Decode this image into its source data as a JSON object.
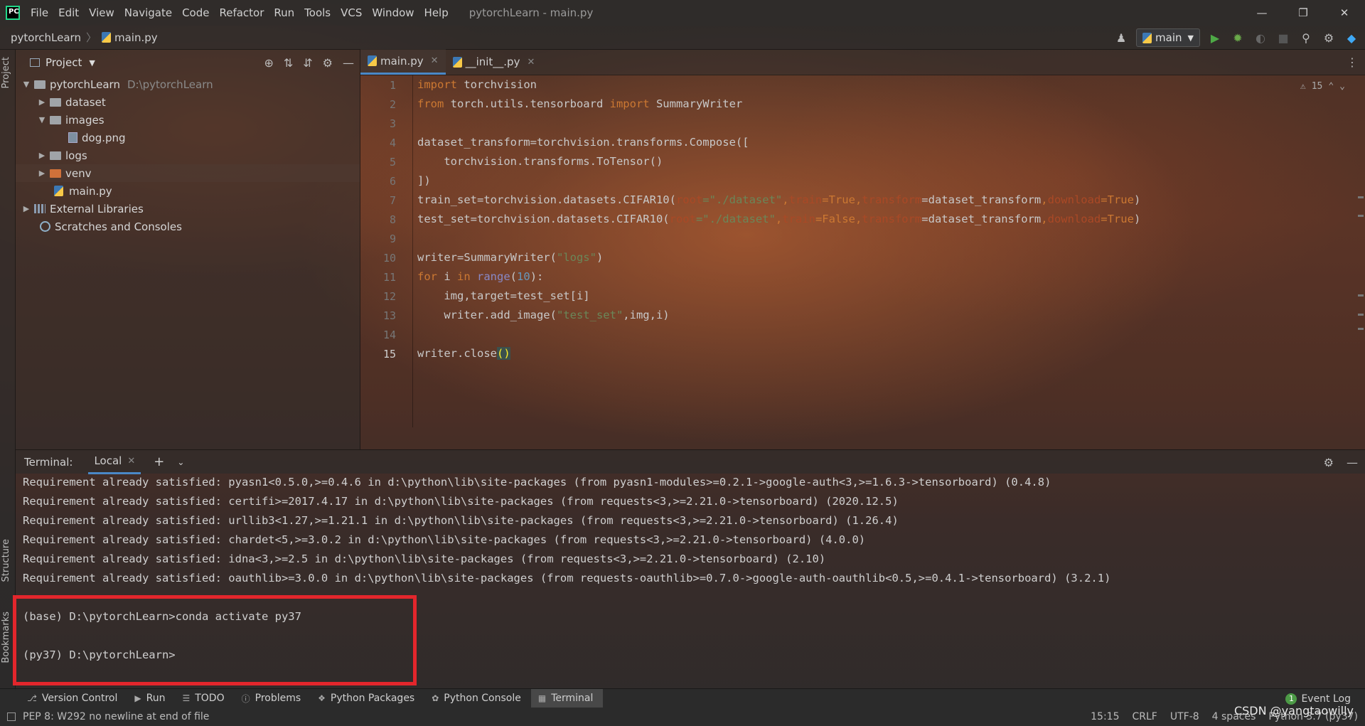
{
  "app": {
    "logo_text": "PC",
    "menu": [
      "File",
      "Edit",
      "View",
      "Navigate",
      "Code",
      "Refactor",
      "Run",
      "Tools",
      "VCS",
      "Window",
      "Help"
    ],
    "window_title": "pytorchLearn - main.py",
    "window_controls": {
      "minimize": "—",
      "restore": "❐",
      "close": "✕"
    }
  },
  "navbar": {
    "project": "pytorchLearn",
    "file": "main.py",
    "run_config": "main"
  },
  "left_stripe": {
    "project_tab": "Project",
    "structure_tab": "Structure",
    "bookmarks_tab": "Bookmarks"
  },
  "project_panel": {
    "title": "Project",
    "tree": {
      "root": {
        "name": "pytorchLearn",
        "path": "D:\\pytorchLearn"
      },
      "dataset": "dataset",
      "images": "images",
      "dog": "dog.png",
      "logs": "logs",
      "venv": "venv",
      "main": "main.py",
      "ext_libs": "External Libraries",
      "scratches": "Scratches and Consoles"
    }
  },
  "editor": {
    "tabs": [
      {
        "label": "main.py"
      },
      {
        "label": "__init__.py"
      }
    ],
    "warnings": "15",
    "line_numbers": [
      "1",
      "2",
      "3",
      "4",
      "5",
      "6",
      "7",
      "8",
      "9",
      "10",
      "11",
      "12",
      "13",
      "14",
      "15"
    ],
    "lines": {
      "l1": {
        "a": "import",
        "b": " torchvision"
      },
      "l2": {
        "a": "from",
        "b": " torch.utils.tensorboard ",
        "c": "import",
        "d": " SummaryWriter"
      },
      "l4": "dataset_transform=torchvision.transforms.Compose([",
      "l5": "    torchvision.transforms.ToTensor()",
      "l6": "])",
      "l7": {
        "a": "train_set=torchvision.datasets.CIFAR10(",
        "p1": "root",
        "s1": "=\"./dataset\"",
        "c1": ",",
        "p2": "train",
        "v2": "=True",
        "c2": ",",
        "p3": "transform",
        "v3": "=dataset_transform",
        "c3": ",",
        "p4": "download",
        "v4": "=True",
        "e": ")"
      },
      "l8": {
        "a": "test_set=torchvision.datasets.CIFAR10(",
        "p1": "root",
        "s1": "=\"./dataset\"",
        "c1": ",",
        "p2": "train",
        "v2": "=False",
        "c2": ",",
        "p3": "transform",
        "v3": "=dataset_transform",
        "c3": ",",
        "p4": "download",
        "v4": "=True",
        "e": ")"
      },
      "l10": {
        "a": "writer=SummaryWriter(",
        "s": "\"logs\"",
        "e": ")"
      },
      "l11": {
        "k1": "for",
        "b": " i ",
        "k2": "in",
        "f": " range",
        "o": "(",
        "n": "10",
        "e": "):"
      },
      "l12": "    img,target=test_set[i]",
      "l13": {
        "a": "    writer.add_image(",
        "s": "\"test_set\"",
        "e": ",img,i)"
      },
      "l15": {
        "a": "writer.close",
        "b": "()"
      }
    }
  },
  "terminal": {
    "label": "Terminal:",
    "tab": "Local",
    "output": [
      "Requirement already satisfied: pyasn1<0.5.0,>=0.4.6 in d:\\python\\lib\\site-packages (from pyasn1-modules>=0.2.1->google-auth<3,>=1.6.3->tensorboard) (0.4.8)",
      "Requirement already satisfied: certifi>=2017.4.17 in d:\\python\\lib\\site-packages (from requests<3,>=2.21.0->tensorboard) (2020.12.5)",
      "Requirement already satisfied: urllib3<1.27,>=1.21.1 in d:\\python\\lib\\site-packages (from requests<3,>=2.21.0->tensorboard) (1.26.4)",
      "Requirement already satisfied: chardet<5,>=3.0.2 in d:\\python\\lib\\site-packages (from requests<3,>=2.21.0->tensorboard) (4.0.0)",
      "Requirement already satisfied: idna<3,>=2.5 in d:\\python\\lib\\site-packages (from requests<3,>=2.21.0->tensorboard) (2.10)",
      "Requirement already satisfied: oauthlib>=3.0.0 in d:\\python\\lib\\site-packages (from requests-oauthlib>=0.7.0->google-auth-oauthlib<0.5,>=0.4.1->tensorboard) (3.2.1)",
      "(base) D:\\pytorchLearn>conda activate py37",
      "(py37) D:\\pytorchLearn>"
    ]
  },
  "toolwindows": [
    "Version Control",
    "Run",
    "TODO",
    "Problems",
    "Python Packages",
    "Python Console",
    "Terminal"
  ],
  "event_log": {
    "count": "1",
    "label": "Event Log"
  },
  "status": {
    "message": "PEP 8: W292 no newline at end of file",
    "position": "15:15",
    "line_sep": "CRLF",
    "encoding": "UTF-8",
    "indent": "4 spaces",
    "interpreter": "Python 3.7 (py37)"
  },
  "watermark": "CSDN @yangtaowilly",
  "colors": {
    "keyword": "#cc7832",
    "string": "#6a8759",
    "number": "#6897bb",
    "param": "#aa4926",
    "highlight_box": "#e3262c"
  }
}
